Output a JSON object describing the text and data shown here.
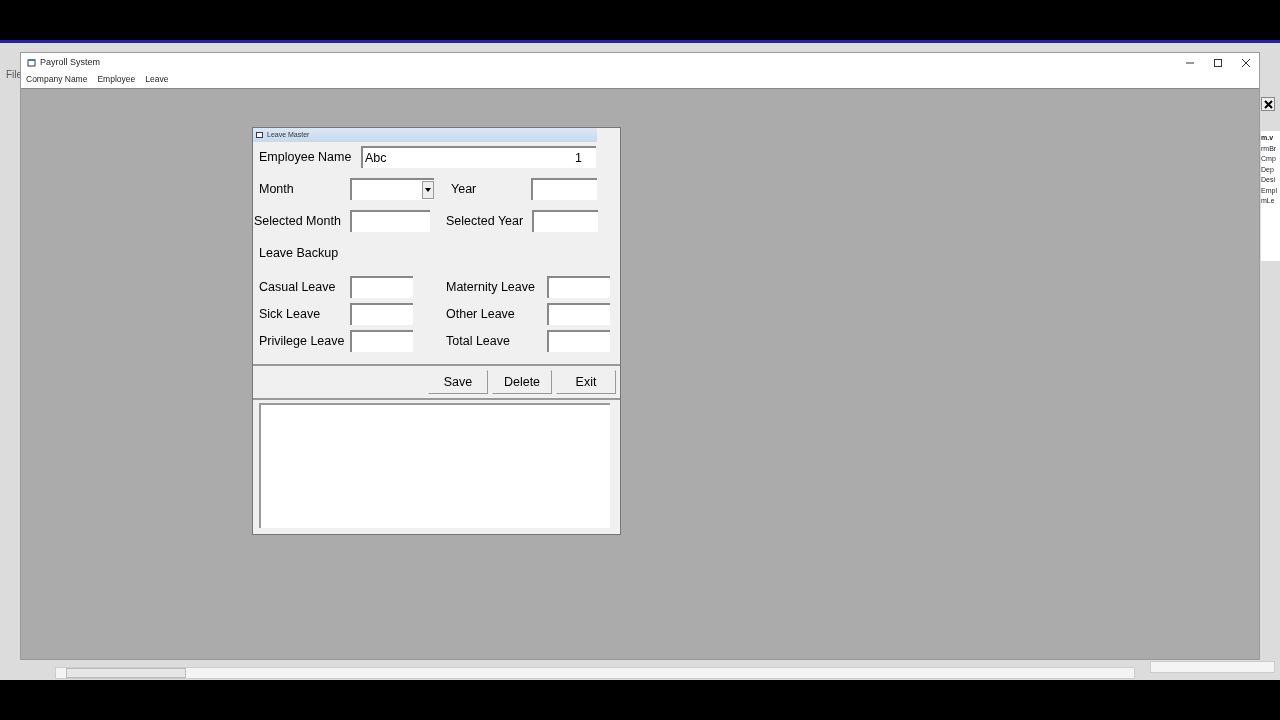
{
  "ide": {
    "menu": [
      "File"
    ],
    "side_panel": {
      "title": "m.v",
      "items": [
        "rmBr",
        "Cmp",
        "Dep",
        "Desi",
        "Empl",
        "mLe"
      ]
    }
  },
  "window": {
    "title": "Payroll System",
    "menu": [
      "Company Name",
      "Employee",
      "Leave"
    ]
  },
  "form": {
    "title": "Leave Master",
    "employee_name": {
      "label": "Employee Name",
      "value": "Abc",
      "number": "1"
    },
    "month": {
      "label": "Month"
    },
    "year": {
      "label": "Year"
    },
    "selected_month": {
      "label": "Selected Month"
    },
    "selected_year": {
      "label": "Selected Year"
    },
    "section": "Leave Backup",
    "leaves": [
      {
        "label": "Casual Leave"
      },
      {
        "label": "Maternity Leave"
      },
      {
        "label": "Sick Leave"
      },
      {
        "label": "Other Leave"
      },
      {
        "label": "Privilege Leave"
      },
      {
        "label": "Total Leave"
      }
    ],
    "buttons": [
      "Save",
      "Delete",
      "Exit"
    ]
  }
}
